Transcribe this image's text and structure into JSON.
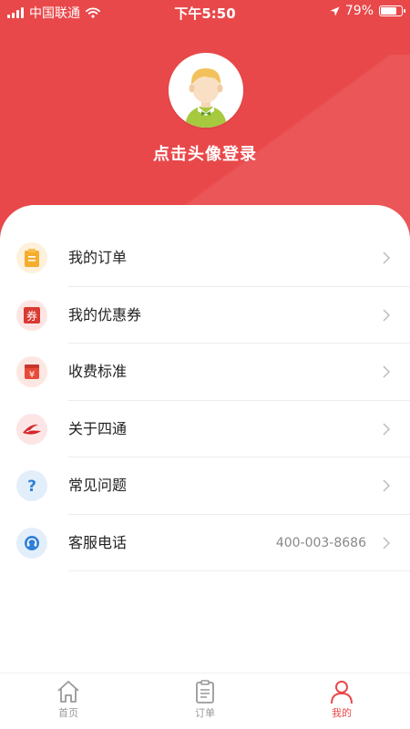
{
  "status_bar": {
    "carrier": "中国联通",
    "time": "下午5:50",
    "battery": "79%",
    "battery_level": 0.79
  },
  "profile": {
    "login_prompt": "点击头像登录"
  },
  "menu": {
    "items": [
      {
        "label": "我的订单",
        "icon": "clipboard-icon",
        "value": ""
      },
      {
        "label": "我的优惠券",
        "icon": "coupon-icon",
        "value": ""
      },
      {
        "label": "收费标准",
        "icon": "price-tag-icon",
        "value": ""
      },
      {
        "label": "关于四通",
        "icon": "logo-icon",
        "value": ""
      },
      {
        "label": "常见问题",
        "icon": "question-icon",
        "value": ""
      },
      {
        "label": "客服电话",
        "icon": "headset-icon",
        "value": "400-003-8686"
      }
    ],
    "coupon_glyph": "券",
    "price_glyph": "¥",
    "question_glyph": "?"
  },
  "tabbar": {
    "tabs": [
      {
        "label": "首页",
        "icon": "home-icon",
        "active": false
      },
      {
        "label": "订单",
        "icon": "order-icon",
        "active": false
      },
      {
        "label": "我的",
        "icon": "user-icon",
        "active": true
      }
    ]
  },
  "colors": {
    "brand_red": "#e9484a",
    "inactive_gray": "#999999"
  }
}
